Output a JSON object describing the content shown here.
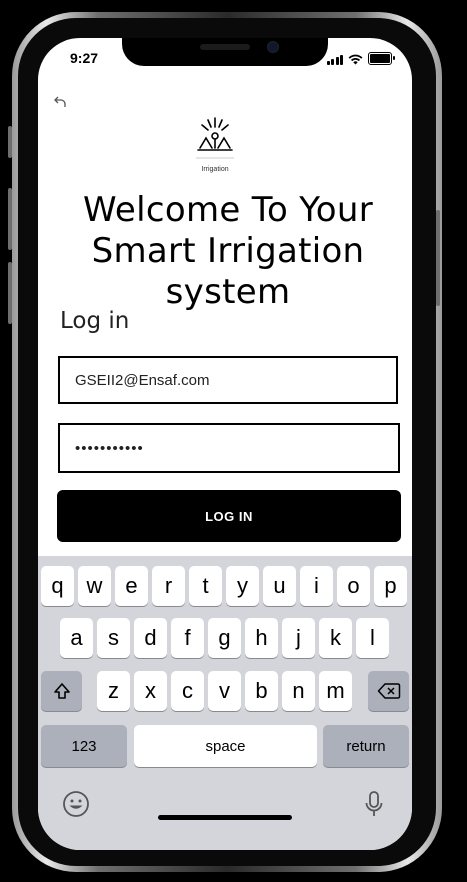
{
  "status_bar": {
    "time": "9:27",
    "icons": [
      "cellular-signal-icon",
      "wifi-icon",
      "battery-icon"
    ]
  },
  "header": {
    "back_icon": "undo-arrow-icon",
    "logo_icon": "irrigation-sprinkler-icon",
    "logo_text": "Irrigation"
  },
  "main": {
    "welcome_title": "Welcome To Your Smart Irrigation system",
    "login_heading": "Log in",
    "email_value": "GSEII2@Ensaf.com",
    "password_value": "•••••••••••",
    "login_button": "LOG IN"
  },
  "keyboard": {
    "row1": [
      "q",
      "w",
      "e",
      "r",
      "t",
      "y",
      "u",
      "i",
      "o",
      "p"
    ],
    "row2": [
      "a",
      "s",
      "d",
      "f",
      "g",
      "h",
      "j",
      "k",
      "l"
    ],
    "row3": [
      "z",
      "x",
      "c",
      "v",
      "b",
      "n",
      "m"
    ],
    "numbers_label": "123",
    "space_label": "space",
    "return_label": "return",
    "icons": [
      "shift-icon",
      "backspace-icon",
      "emoji-icon",
      "microphone-icon"
    ]
  }
}
